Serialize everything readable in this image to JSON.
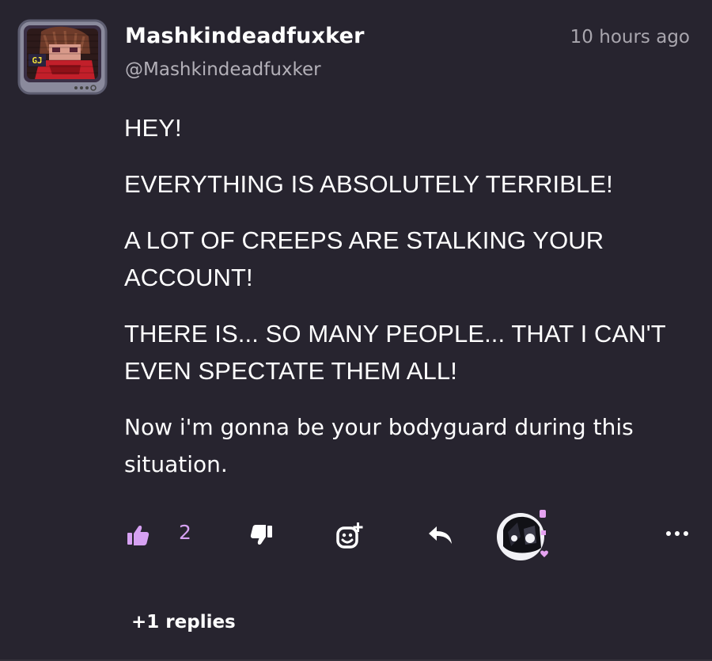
{
  "comment": {
    "author": {
      "display_name": "Mashkindeadfuxker",
      "handle": "@Mashkindeadfuxker",
      "avatar_icon": "tv-avatar-icon"
    },
    "timestamp": "10 hours ago",
    "paragraphs": [
      "HEY!",
      "EVERYTHING IS ABSOLUTELY TERRIBLE!",
      "A LOT OF CREEPS ARE STALKING YOUR ACCOUNT!",
      "THERE IS... SO MANY PEOPLE... THAT I CAN'T EVEN SPECTATE THEM ALL!",
      "Now i'm gonna be your bodyguard during this situation."
    ],
    "actions": {
      "like_count": "2",
      "like_icon": "thumbs-up-icon",
      "dislike_icon": "thumbs-down-icon",
      "react_icon": "add-reaction-icon",
      "reply_icon": "reply-arrow-icon",
      "more_icon": "more-dots-icon"
    },
    "replies_label": "+1 replies"
  },
  "colors": {
    "background": "#27242f",
    "accent": "#d6a1f2",
    "muted_text": "#b3b0b8"
  }
}
